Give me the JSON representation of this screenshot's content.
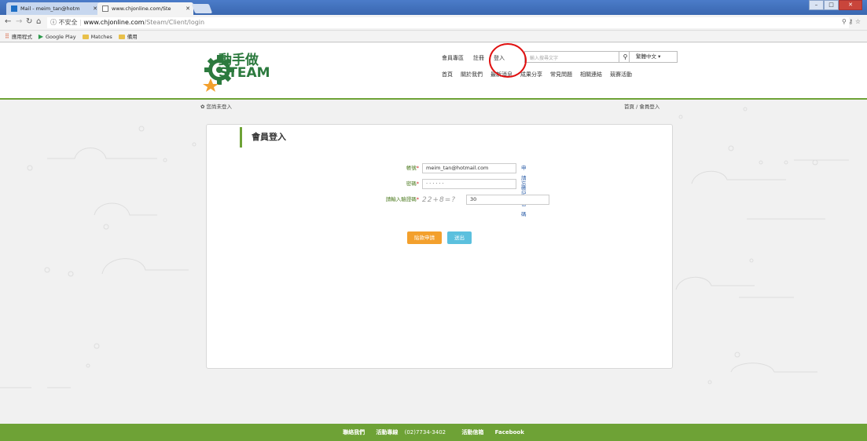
{
  "browser": {
    "tabs": [
      {
        "title": "Mail - meim_tan@hotm",
        "active": false
      },
      {
        "title": "www.chjonline.com/Ste",
        "active": true
      }
    ],
    "address": {
      "security": "不安全",
      "host": "www.chjonline.com",
      "path": "/Steam/Client/login"
    },
    "bookmarks": [
      {
        "label": "應用程式",
        "icon": "apps-icon"
      },
      {
        "label": "Google Play",
        "icon": "play-icon"
      },
      {
        "label": "Matches",
        "icon": "folder-icon"
      },
      {
        "label": "備用",
        "icon": "folder-icon"
      }
    ]
  },
  "site": {
    "logo": {
      "line1": "動手做",
      "line2": "STEAM"
    },
    "topnav": [
      "會員專區",
      "註冊",
      "登入"
    ],
    "search": {
      "placeholder": "輸入搜尋文字"
    },
    "language": "繁體中文 ▾",
    "mainnav": [
      "首頁",
      "關於我們",
      "最新消息",
      "成果分享",
      "常見問題",
      "相關連結",
      "競賽活動"
    ]
  },
  "status": "您尚未登入",
  "breadcrumb": "首頁 / 會員登入",
  "login": {
    "title": "會員登入",
    "account_label": "帳號",
    "account_value": "meim_tan@hotmail.com",
    "apply_link": "申請帳號",
    "password_label": "密碼",
    "password_value": "· · · · · ·",
    "forgot_link": "忘記密碼",
    "captcha_label": "請輸入驗證碼",
    "captcha_image_text": "22+8=?",
    "captcha_value": "30",
    "register_button": "貼款申請",
    "login_button": "送出"
  },
  "footer": {
    "contact": "聯絡我們",
    "hotline_label": "活動專線",
    "hotline": "(02)7734-3402",
    "mail": "活動信箱",
    "facebook": "Facebook"
  },
  "colors": {
    "accent": "#6ea236",
    "link": "#2c5ea8",
    "orange": "#f3a02d",
    "cyan": "#5bc0de",
    "annotation": "#e01010"
  }
}
